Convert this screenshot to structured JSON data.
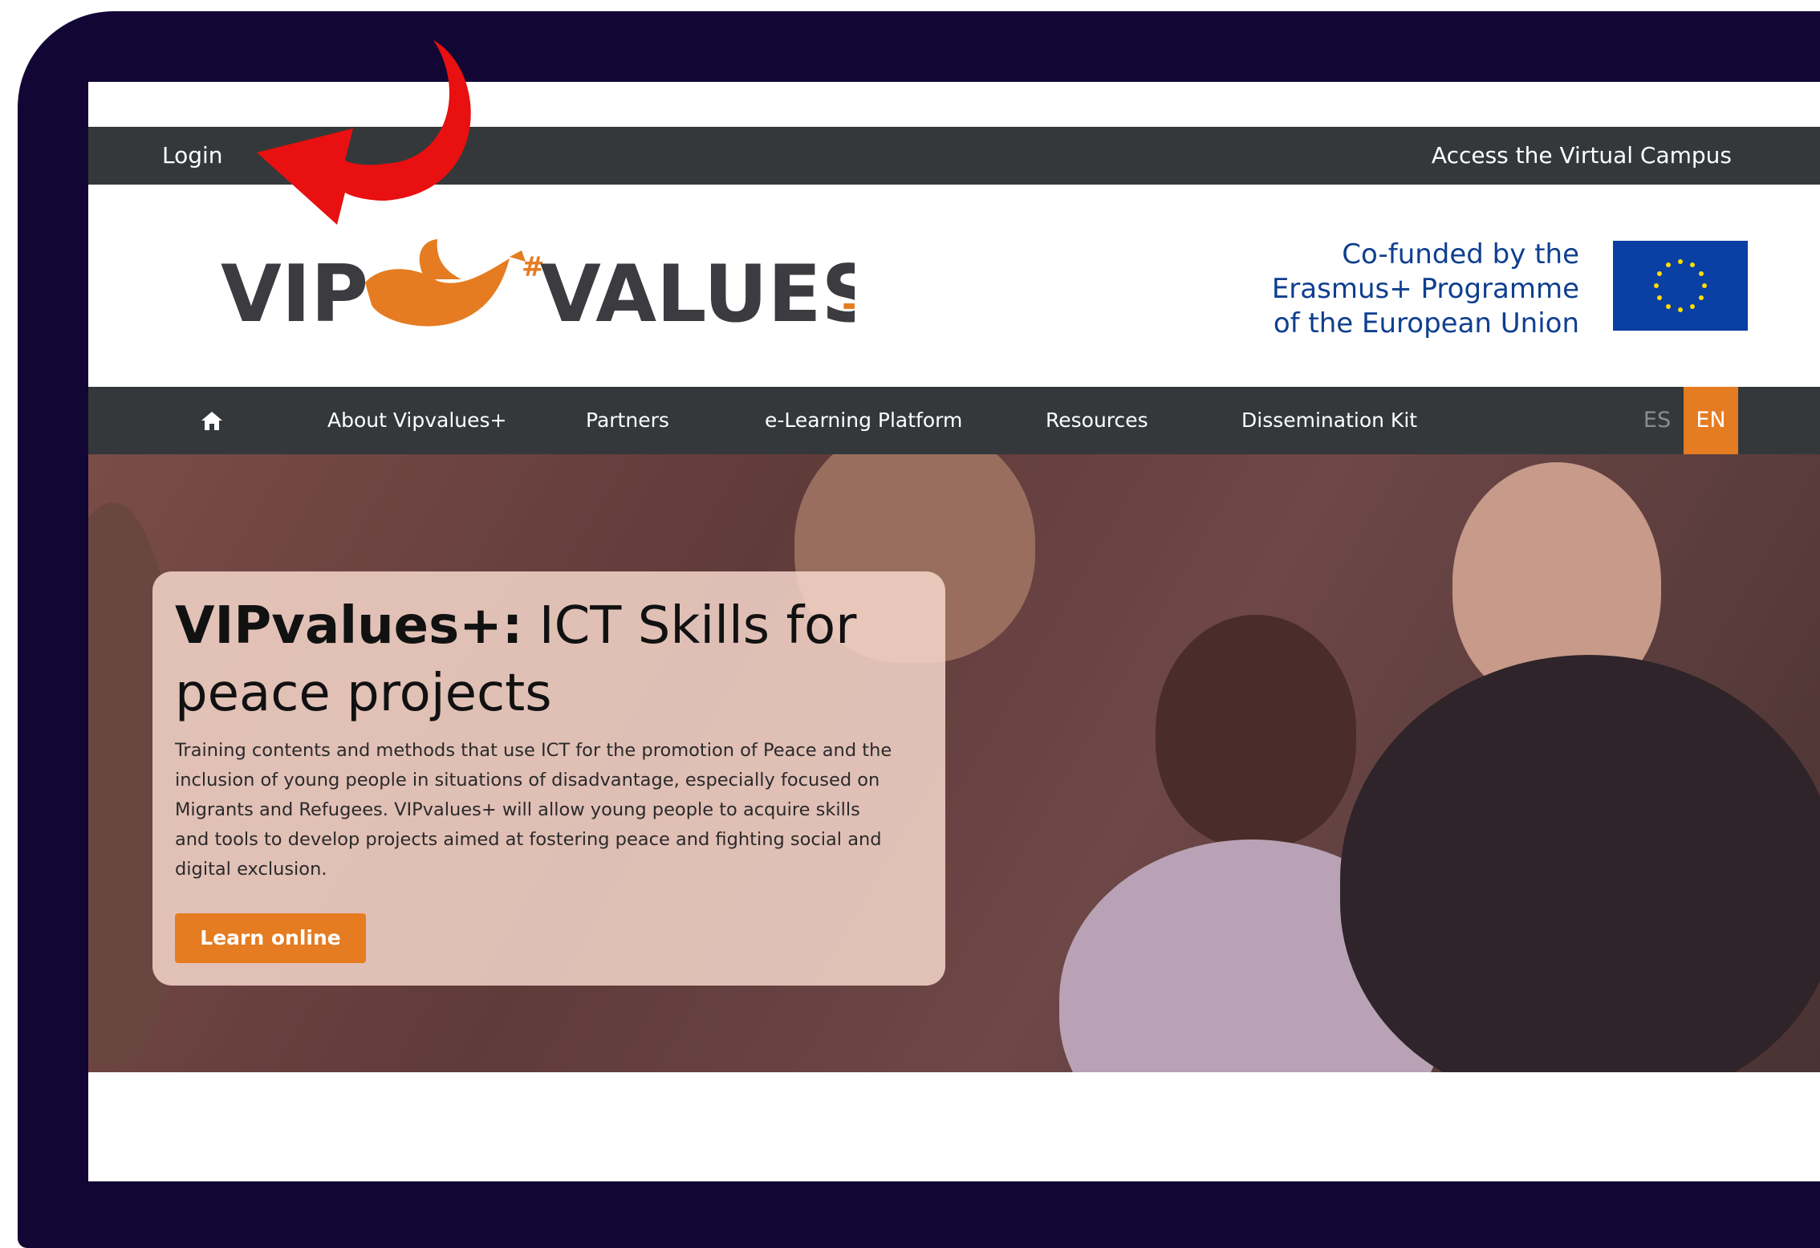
{
  "topbar": {
    "login": "Login",
    "campus": "Access the Virtual Campus"
  },
  "logo": {
    "left": "VIP",
    "right": "VALUES",
    "plus": "+"
  },
  "erasmus": {
    "line1": "Co-funded by the",
    "line2": "Erasmus+ Programme",
    "line3": "of the European Union"
  },
  "nav": {
    "home_icon": "home-icon",
    "items": [
      "About Vipvalues+",
      "Partners",
      "e-Learning Platform",
      "Resources",
      "Dissemination Kit"
    ],
    "lang": {
      "es": "ES",
      "en": "EN"
    }
  },
  "hero": {
    "title_bold": "VIPvalues+:",
    "title_rest": " ICT Skills for peace projects",
    "description": "Training contents and methods that use ICT for the promotion of Peace and the inclusion of young people in situations of disadvantage, especially focused on Migrants and Refugees. VIPvalues+ will allow young people to acquire skills and tools to develop projects aimed at fostering peace and fighting social and digital exclusion.",
    "button": "Learn online"
  },
  "colors": {
    "dark_bar": "#34383a",
    "accent": "#e57c21",
    "frame": "#120734",
    "annotation_arrow": "#e81010"
  }
}
